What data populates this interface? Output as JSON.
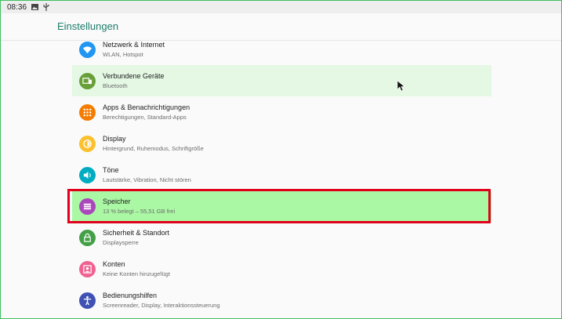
{
  "statusbar": {
    "time": "08:36",
    "icons": [
      "image-icon",
      "usb-icon"
    ]
  },
  "appbar": {
    "title": "Einstellungen"
  },
  "items": [
    {
      "label": "Netzwerk & Internet",
      "sub": "WLAN, Hotspot",
      "icon": "wifi-icon",
      "color": "#2196f3"
    },
    {
      "label": "Verbundene Geräte",
      "sub": "Bluetooth",
      "icon": "devices-icon",
      "color": "#689f38"
    },
    {
      "label": "Apps & Benachrichtigungen",
      "sub": "Berechtigungen, Standard-Apps",
      "icon": "apps-icon",
      "color": "#f57c00"
    },
    {
      "label": "Display",
      "sub": "Hintergrund, Ruhemodus, Schriftgröße",
      "icon": "brightness-icon",
      "color": "#fbc02d"
    },
    {
      "label": "Töne",
      "sub": "Lautstärke, Vibration, Nicht stören",
      "icon": "volume-icon",
      "color": "#00acc1"
    },
    {
      "label": "Speicher",
      "sub": "13 % belegt – 55,51 GB frei",
      "icon": "storage-icon",
      "color": "#ab47bc"
    },
    {
      "label": "Sicherheit & Standort",
      "sub": "Displaysperre",
      "icon": "lock-icon",
      "color": "#43a047"
    },
    {
      "label": "Konten",
      "sub": "Keine Konten hinzugefügt",
      "icon": "account-icon",
      "color": "#f06292"
    },
    {
      "label": "Bedienungshilfen",
      "sub": "Screenreader, Display, Interaktionssteuerung",
      "icon": "accessibility-icon",
      "color": "#3f51b5"
    }
  ]
}
